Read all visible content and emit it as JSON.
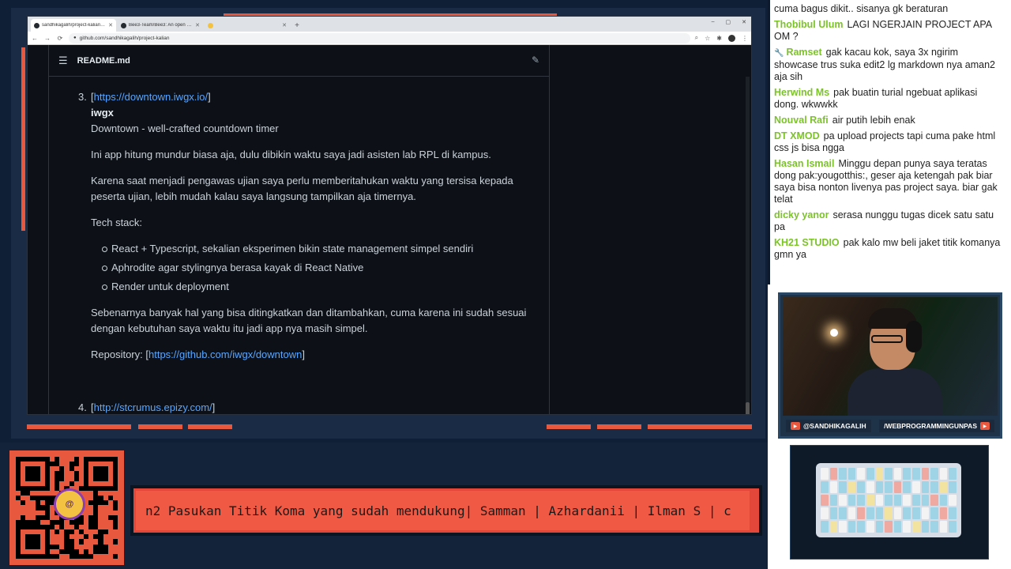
{
  "browser": {
    "tabs": [
      {
        "label": "sandhikagalih/project-kalian: Mi",
        "icon_color": "#24292f",
        "active": true
      },
      {
        "label": "Bee3-Team/Bee3: An open sourc",
        "icon_color": "#24292f",
        "active": false
      },
      {
        "label": "",
        "icon_color": "#f3c242",
        "active": false
      }
    ],
    "new_tab": "+",
    "window_controls": [
      "–",
      "▢",
      "✕"
    ],
    "url": "github.com/sandhikagalih/project-kalian",
    "lock_icon": "🔒"
  },
  "readme": {
    "title": "README.md",
    "item3": {
      "number": "3.",
      "link_open": "[",
      "link": "https://downtown.iwgx.io/",
      "link_close": "]",
      "name": "iwgx",
      "tagline": "Downtown - well-crafted countdown timer",
      "p1": "Ini app hitung mundur biasa aja, dulu dibikin waktu saya jadi asisten lab RPL di kampus.",
      "p2": "Karena saat menjadi pengawas ujian saya perlu memberitahukan waktu yang tersisa kepada peserta ujian, lebih mudah kalau saya langsung tampilkan aja timernya.",
      "tech_label": "Tech stack:",
      "tech": [
        "React + Typescript, sekalian eksperimen bikin state management simpel sendiri",
        "Aphrodite agar stylingnya berasa kayak di React Native",
        "Render untuk deployment"
      ],
      "p3": "Sebenarnya banyak hal yang bisa ditingkatkan dan ditambahkan, cuma karena ini sudah sesuai dengan kebutuhan saya waktu itu jadi app nya masih simpel.",
      "repo_label": "Repository: [",
      "repo_link": "https://github.com/iwgx/downtown",
      "repo_close": "]"
    },
    "item4": {
      "number": "4.",
      "link_open": "[",
      "link": "http://stcrumus.epizy.com/",
      "link_close": "]"
    }
  },
  "chat": [
    {
      "author": "",
      "text": "cuma bagus dikit.. sisanya gk beraturan"
    },
    {
      "author": "Thobibul Ulum",
      "text": "LAGI NGERJAIN PROJECT APA OM ?"
    },
    {
      "author": "Ramset",
      "text": "gak kacau kok, saya 3x ngirim showcase trus suka edit2 lg markdown nya aman2 aja sih",
      "badge": "🔧"
    },
    {
      "author": "Herwind Ms",
      "text": "pak buatin turial ngebuat aplikasi dong. wkwwkk"
    },
    {
      "author": "Nouval Rafi",
      "text": "air putih lebih enak"
    },
    {
      "author": "DT XMOD",
      "text": "pa upload projects tapi cuma pake html css js bisa ngga"
    },
    {
      "author": "Hasan Ismail",
      "text": "Minggu depan punya saya teratas dong pak:yougotthis:, geser aja ketengah pak biar saya bisa nonton livenya pas project saya. biar gak telat"
    },
    {
      "author": "dicky yanor",
      "text": "serasa nunggu tugas dicek satu satu pa"
    },
    {
      "author": "KH21 STUDIO",
      "text": "pak kalo mw beli jaket titik komanya gmn ya"
    }
  ],
  "camera": {
    "handle_left": "@SANDHIKAGALIH",
    "handle_right": "/WEBPROGRAMMINGUNPAS"
  },
  "qr": {
    "mascot_text": "@"
  },
  "ticker": {
    "text": "n2 Pasukan Titik Koma yang sudah mendukung| Samman | Azhardanii | Ilman S | c"
  },
  "colors": {
    "accent": "#e8583f",
    "chat_author": "#7cc32a",
    "link": "#58a6ff"
  }
}
